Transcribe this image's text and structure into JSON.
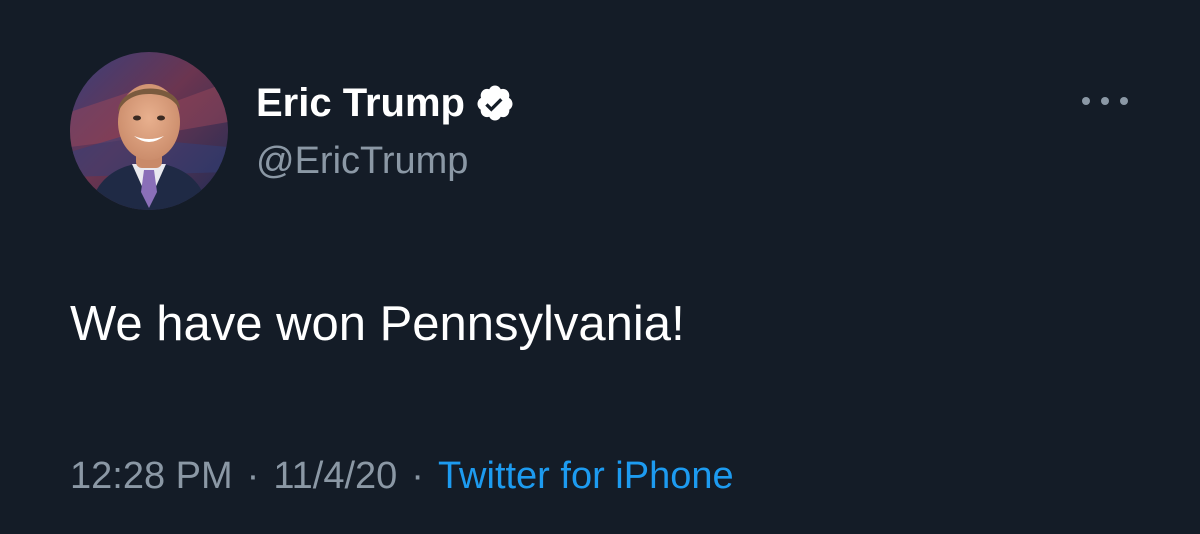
{
  "tweet": {
    "display_name": "Eric Trump",
    "handle": "@EricTrump",
    "verified": true,
    "text": "We have won Pennsylvania!",
    "time": "12:28 PM",
    "date": "11/4/20",
    "source": "Twitter for iPhone",
    "separator": "·"
  },
  "icons": {
    "verified": "verified-check-icon",
    "more": "more-horizontal-icon"
  },
  "colors": {
    "background": "#141c27",
    "primary_text": "#ffffff",
    "secondary_text": "#8b98a5",
    "link": "#1d9bf0"
  }
}
